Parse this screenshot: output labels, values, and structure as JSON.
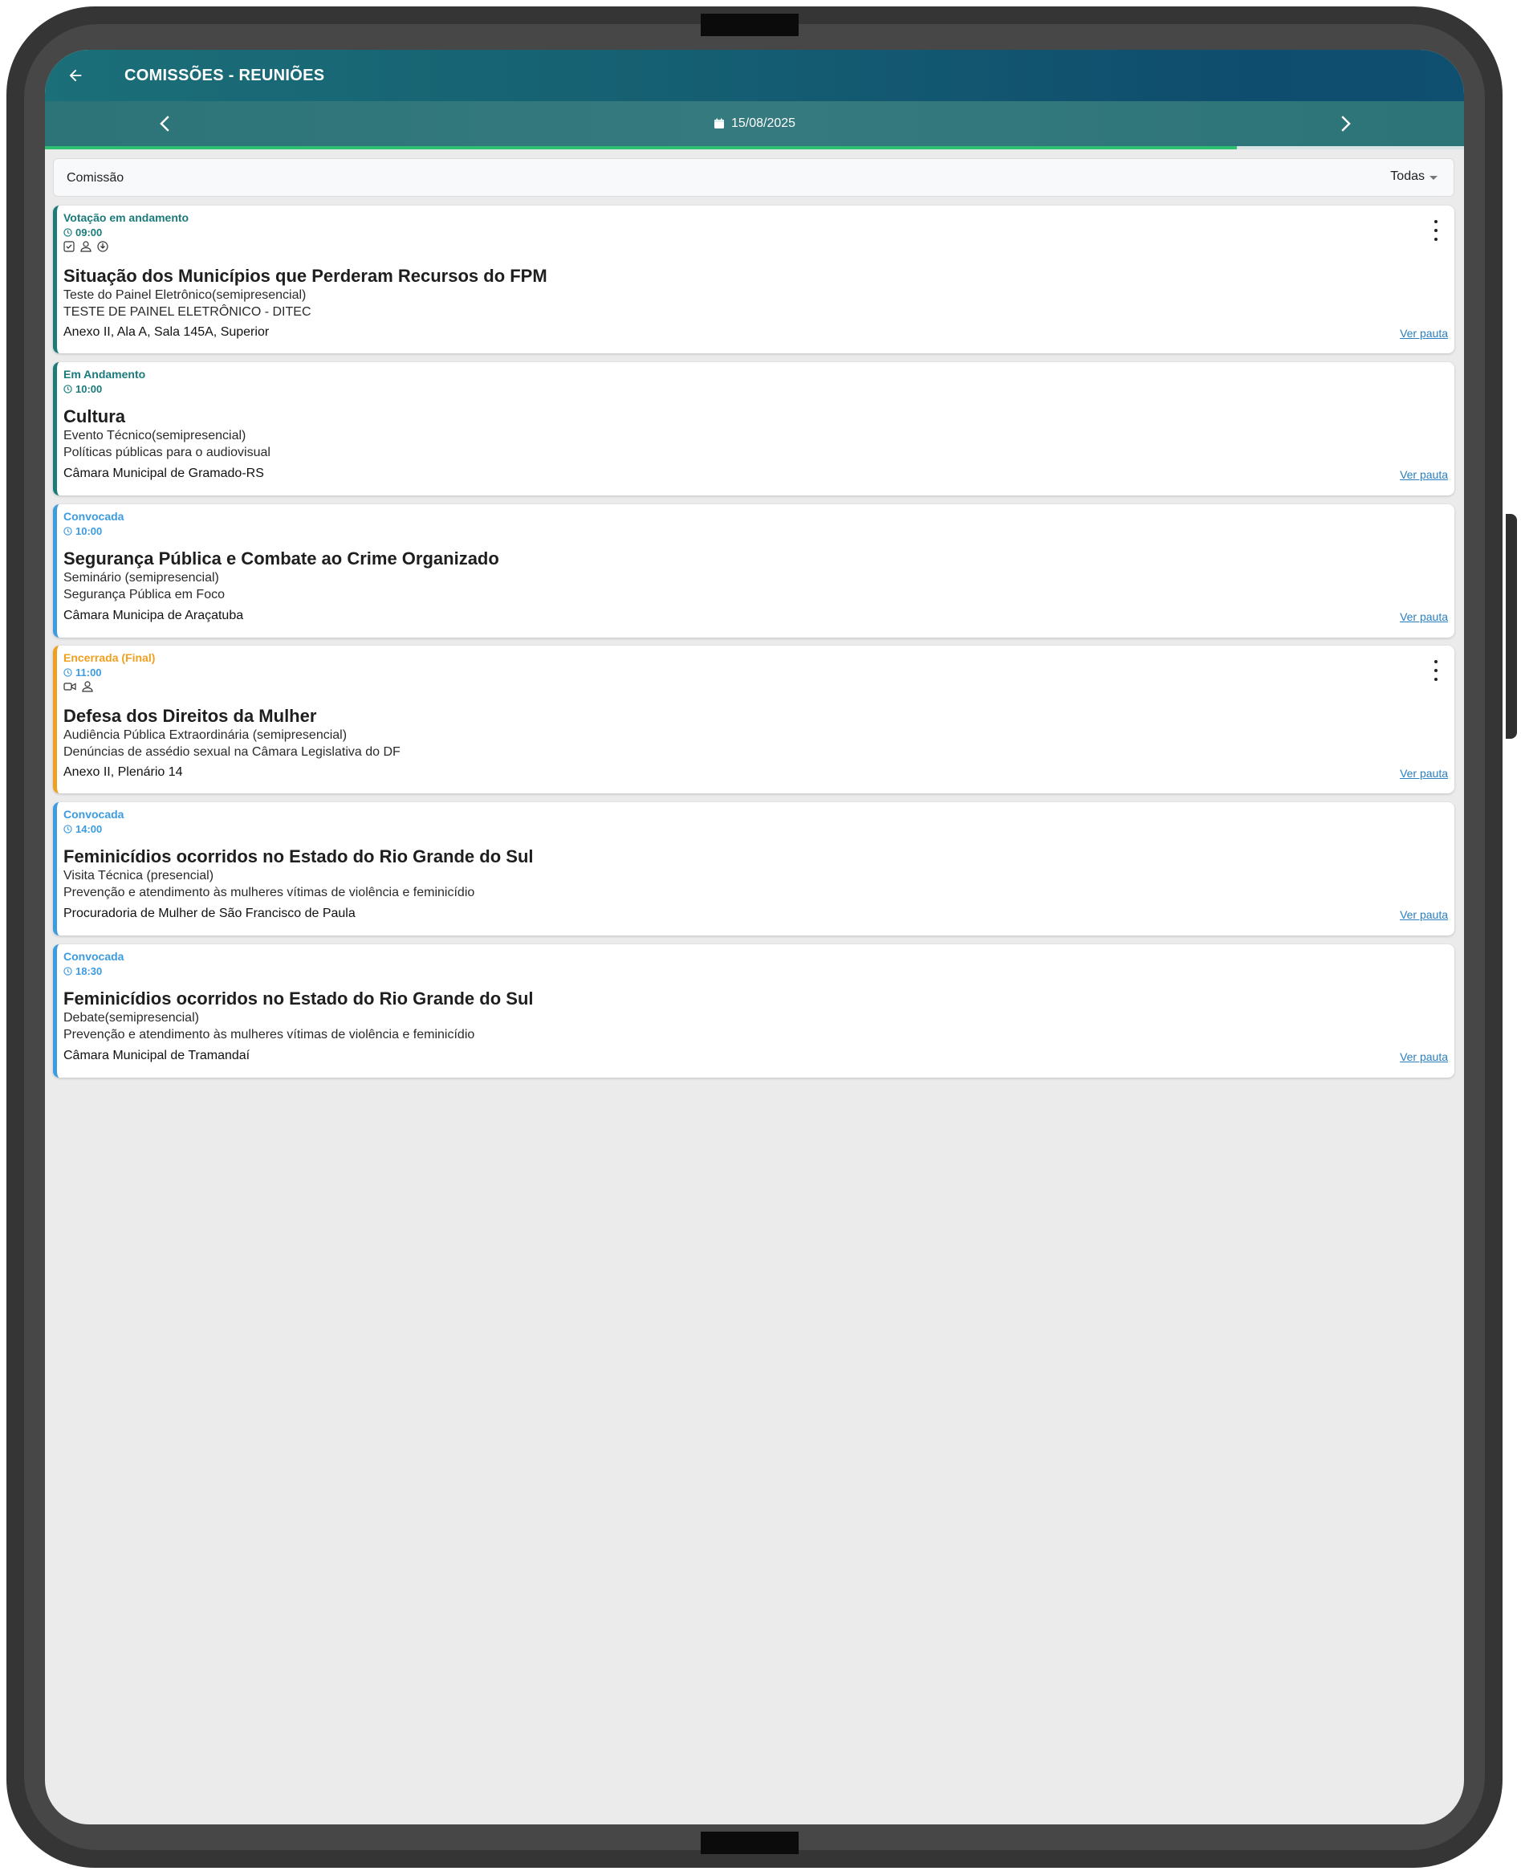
{
  "header": {
    "title": "COMISSÕES - REUNIÕES"
  },
  "datebar": {
    "date": "15/08/2025",
    "progress_percent": 84
  },
  "filter": {
    "label": "Comissão",
    "selected": "Todas"
  },
  "colors": {
    "teal": "#1b7a7a",
    "blue": "#3d9be0",
    "orange": "#f0a020",
    "link": "#2a7fbf"
  },
  "meetings": [
    {
      "status": "Votação em andamento",
      "time": "09:00",
      "icons": [
        "check-square-icon",
        "person-icon",
        "vote-icon"
      ],
      "title": "Situação dos Municípios que Perderam Recursos do FPM",
      "type": "Teste do Painel Eletrônico(semipresencial)",
      "subject": "TESTE DE PAINEL ELETRÔNICO - DITEC",
      "place": "Anexo II, Ala A, Sala 145A, Superior",
      "link": "Ver pauta"
    },
    {
      "status": "Em Andamento",
      "time": "10:00",
      "title": "Cultura",
      "type": "Evento Técnico(semipresencial)",
      "subject": "Políticas públicas para o audiovisual",
      "place": "Câmara Municipal de Gramado-RS",
      "link": "Ver pauta"
    },
    {
      "status": "Convocada",
      "time": "10:00",
      "title": "Segurança Pública e Combate ao Crime Organizado",
      "type": "Seminário (semipresencial)",
      "subject": "Segurança Pública em Foco",
      "place": "Câmara Municipa de Araçatuba",
      "link": "Ver pauta"
    },
    {
      "status": "Encerrada (Final)",
      "time": "11:00",
      "icons": [
        "video-icon",
        "person-icon"
      ],
      "title": "Defesa dos Direitos da Mulher",
      "type": "Audiência Pública Extraordinária (semipresencial)",
      "subject": "Denúncias de assédio sexual na Câmara Legislativa do DF",
      "place": "Anexo II, Plenário 14",
      "link": "Ver pauta"
    },
    {
      "status": "Convocada",
      "time": "14:00",
      "title": "Feminicídios ocorridos no Estado do Rio Grande do Sul",
      "type": "Visita Técnica (presencial)",
      "subject": "Prevenção e atendimento às mulheres vítimas de violência e feminicídio",
      "place": "Procuradoria de Mulher de São Francisco de Paula",
      "link": "Ver pauta"
    },
    {
      "status": "Convocada",
      "time": "18:30",
      "title": "Feminicídios ocorridos no Estado do Rio Grande do Sul",
      "type": "Debate(semipresencial)",
      "subject": "Prevenção e atendimento às mulheres vítimas de violência e feminicídio",
      "place": "Câmara Municipal de Tramandaí",
      "link": "Ver pauta"
    }
  ]
}
